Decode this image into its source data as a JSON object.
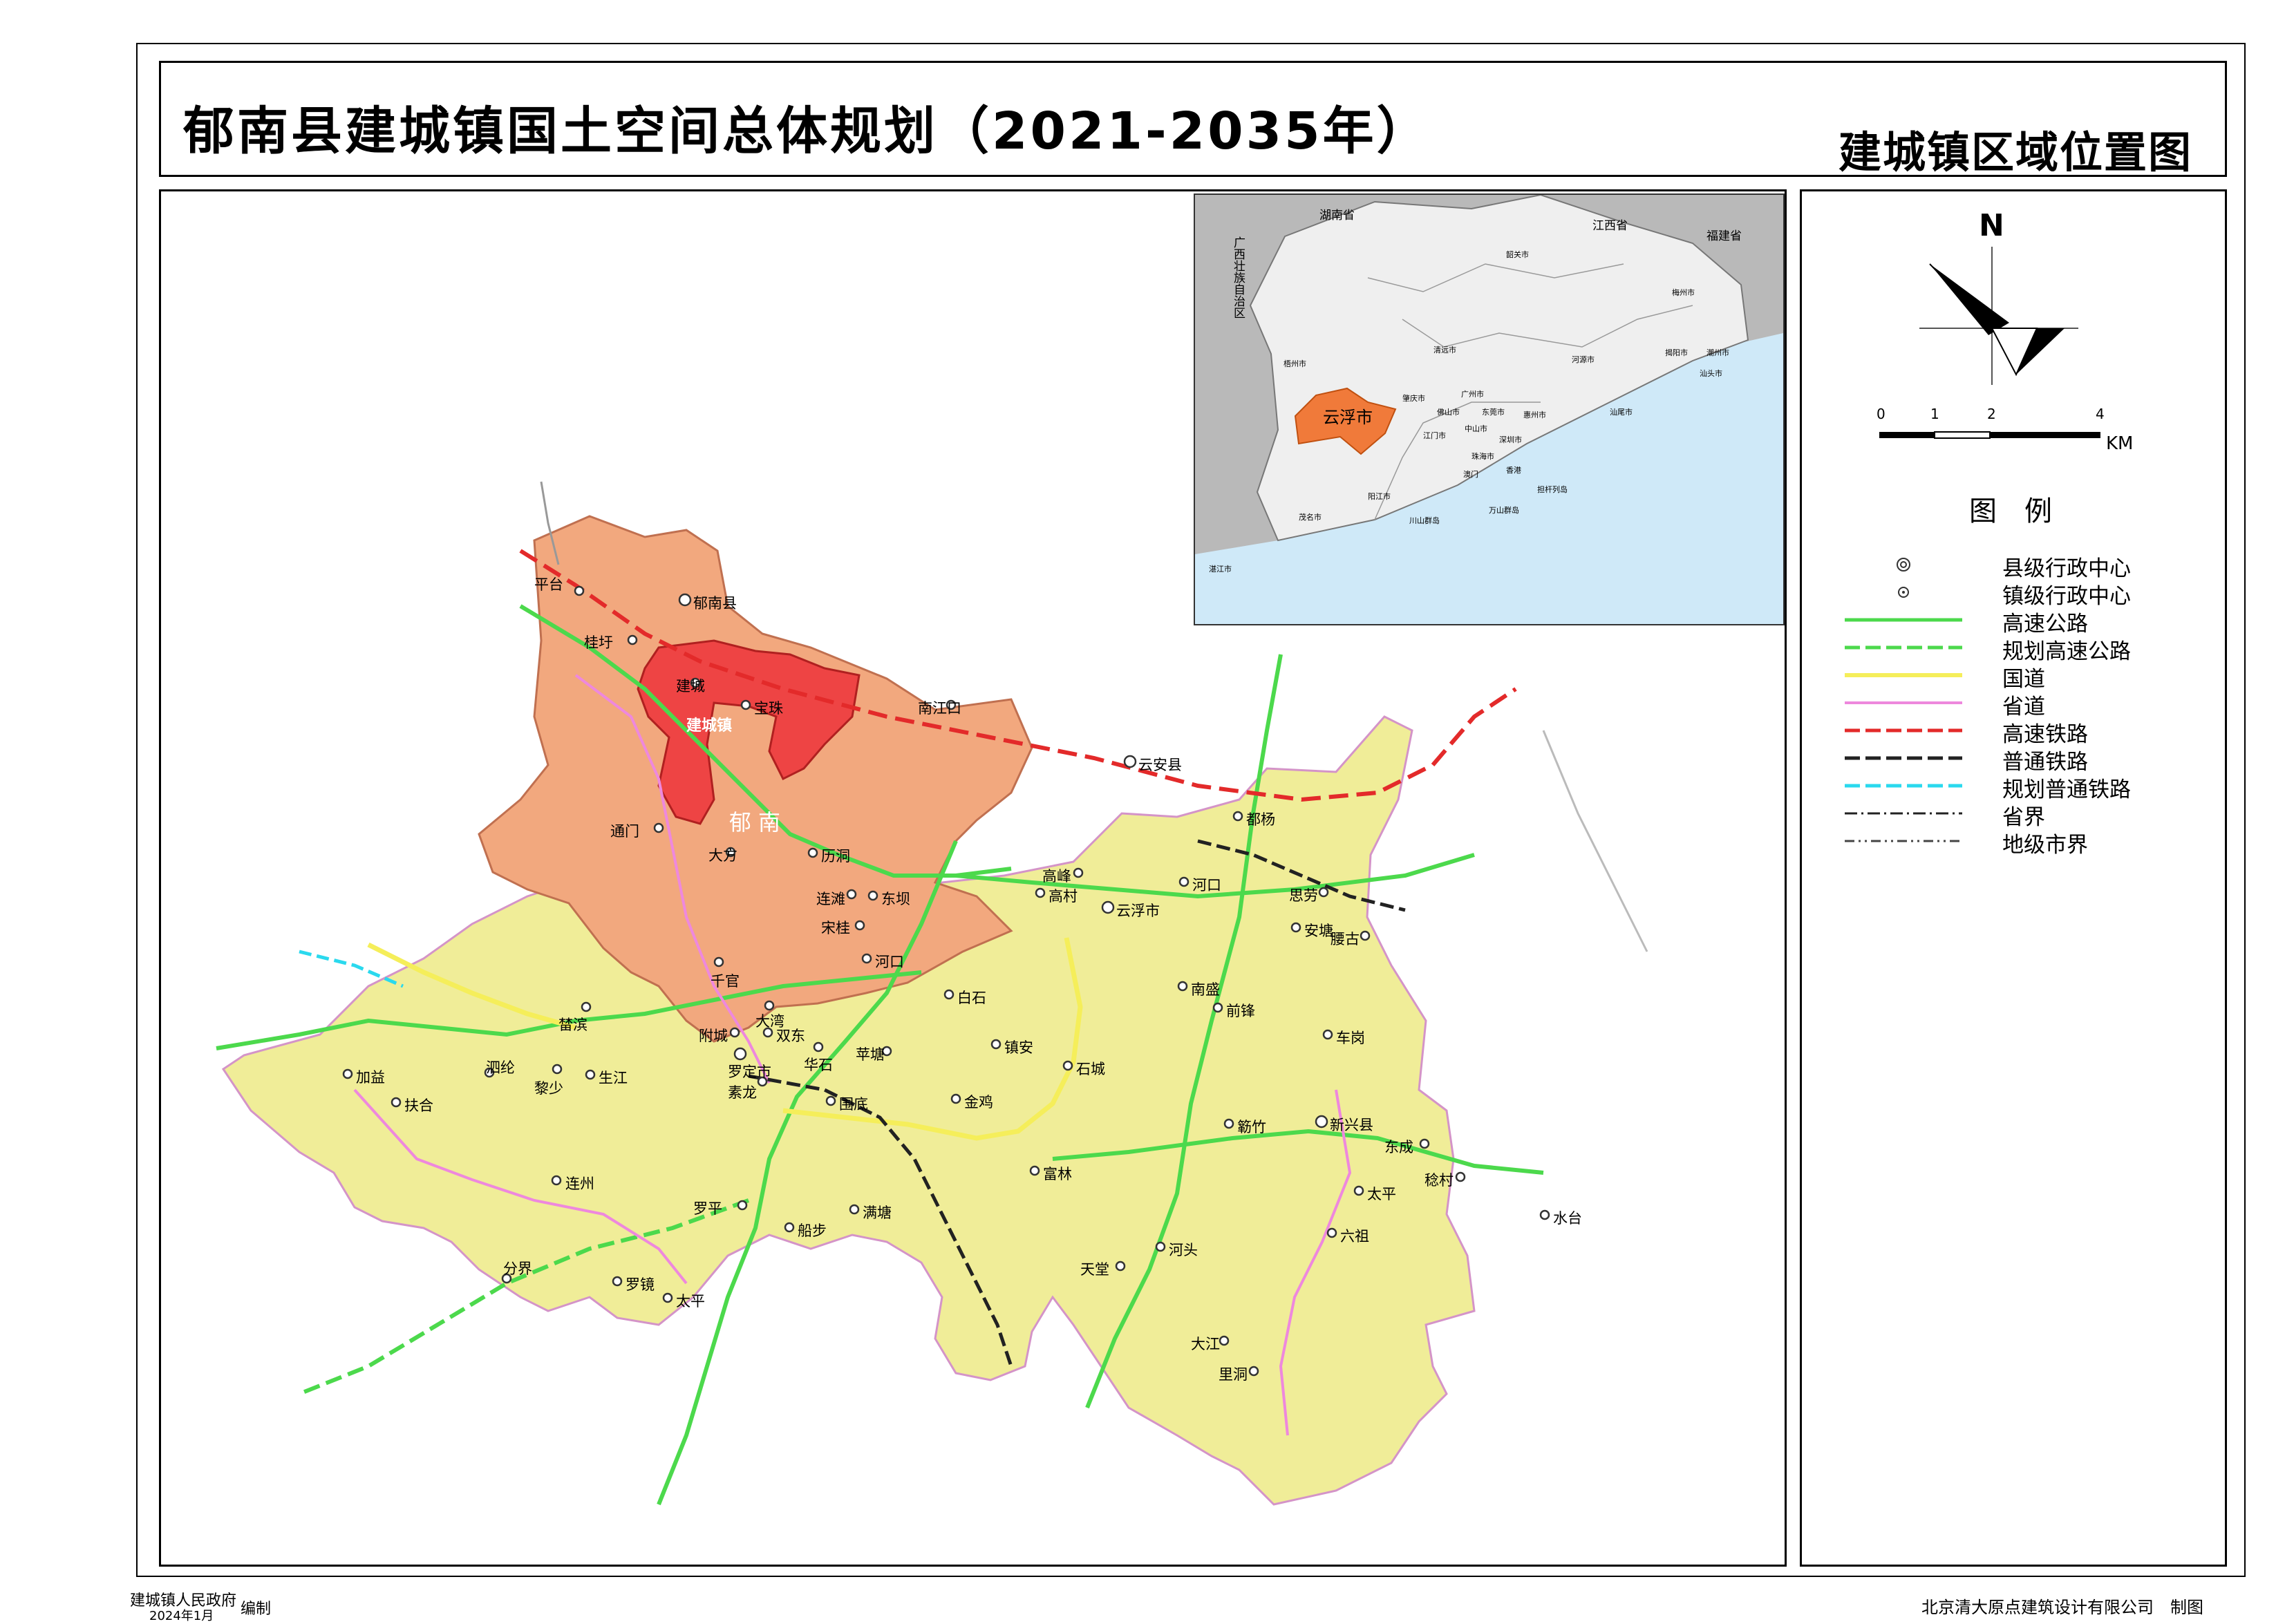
{
  "title": "郁南县建城镇国土空间总体规划（2021-2035年）",
  "subtitle": "建城镇区域位置图",
  "north_arrow": {
    "label": "N"
  },
  "scale_bar": {
    "ticks": [
      "0",
      "1",
      "2",
      "4"
    ],
    "unit": "KM"
  },
  "legend": {
    "title": "图　例",
    "items": [
      {
        "label": "县级行政中心",
        "symbol": "county-center",
        "color": "#333333"
      },
      {
        "label": "镇级行政中心",
        "symbol": "town-center",
        "color": "#333333"
      },
      {
        "label": "高速公路",
        "symbol": "line-solid",
        "color": "#4cd94c"
      },
      {
        "label": "规划高速公路",
        "symbol": "line-dashed",
        "color": "#4cd94c"
      },
      {
        "label": "国道",
        "symbol": "line-solid",
        "color": "#f5ee5a"
      },
      {
        "label": "省道",
        "symbol": "line-solid",
        "color": "#ee88dd"
      },
      {
        "label": "高速铁路",
        "symbol": "line-dashed",
        "color": "#e32a2a"
      },
      {
        "label": "普通铁路",
        "symbol": "line-dashed",
        "color": "#222222"
      },
      {
        "label": "规划普通铁路",
        "symbol": "line-dashed",
        "color": "#2ad9ee"
      },
      {
        "label": "省界",
        "symbol": "line-dashdot",
        "color": "#222222"
      },
      {
        "label": "地级市界",
        "symbol": "line-dashdot",
        "color": "#444444"
      }
    ]
  },
  "colors": {
    "county_fill": "#f2a87e",
    "town_fill": "#ee4444",
    "region_fill": "#f0ed98",
    "inset_city_fill": "#f07a3a",
    "sea": "#cfe9f8",
    "outside": "#b9b9b9"
  },
  "map": {
    "county_label": "郁南",
    "town_label": "建城镇",
    "places": [
      {
        "name": "郁南县",
        "type": "county"
      },
      {
        "name": "平台",
        "type": "town"
      },
      {
        "name": "桂圩",
        "type": "town"
      },
      {
        "name": "建城",
        "type": "town"
      },
      {
        "name": "宝珠",
        "type": "town"
      },
      {
        "name": "南江口",
        "type": "town"
      },
      {
        "name": "通门",
        "type": "town"
      },
      {
        "name": "大方",
        "type": "town"
      },
      {
        "name": "历洞",
        "type": "town"
      },
      {
        "name": "连滩",
        "type": "town"
      },
      {
        "name": "东坝",
        "type": "town"
      },
      {
        "name": "宋桂",
        "type": "town"
      },
      {
        "name": "千官",
        "type": "town"
      },
      {
        "name": "河口",
        "type": "town"
      },
      {
        "name": "云安县",
        "type": "county"
      },
      {
        "name": "都杨",
        "type": "town"
      },
      {
        "name": "高村",
        "type": "town"
      },
      {
        "name": "高峰",
        "type": "town"
      },
      {
        "name": "河口",
        "type": "town"
      },
      {
        "name": "云浮市",
        "type": "county"
      },
      {
        "name": "思劳",
        "type": "town"
      },
      {
        "name": "安塘",
        "type": "town"
      },
      {
        "name": "腰古",
        "type": "town"
      },
      {
        "name": "南盛",
        "type": "town"
      },
      {
        "name": "前锋",
        "type": "town"
      },
      {
        "name": "白石",
        "type": "town"
      },
      {
        "name": "大湾",
        "type": "town"
      },
      {
        "name": "榃滨",
        "type": "town"
      },
      {
        "name": "附城",
        "type": "town"
      },
      {
        "name": "双东",
        "type": "town"
      },
      {
        "name": "罗定市",
        "type": "county"
      },
      {
        "name": "华石",
        "type": "town"
      },
      {
        "name": "苹塘",
        "type": "town"
      },
      {
        "name": "镇安",
        "type": "town"
      },
      {
        "name": "石城",
        "type": "town"
      },
      {
        "name": "车岗",
        "type": "town"
      },
      {
        "name": "加益",
        "type": "town"
      },
      {
        "name": "扶合",
        "type": "town"
      },
      {
        "name": "泗纶",
        "type": "town"
      },
      {
        "name": "黎少",
        "type": "town"
      },
      {
        "name": "生江",
        "type": "town"
      },
      {
        "name": "素龙",
        "type": "town"
      },
      {
        "name": "围底",
        "type": "town"
      },
      {
        "name": "金鸡",
        "type": "town"
      },
      {
        "name": "簕竹",
        "type": "town"
      },
      {
        "name": "新兴县",
        "type": "county"
      },
      {
        "name": "东成",
        "type": "town"
      },
      {
        "name": "稔村",
        "type": "town"
      },
      {
        "name": "富林",
        "type": "town"
      },
      {
        "name": "连州",
        "type": "town"
      },
      {
        "name": "太平",
        "type": "town"
      },
      {
        "name": "水台",
        "type": "town"
      },
      {
        "name": "罗平",
        "type": "town"
      },
      {
        "name": "船步",
        "type": "town"
      },
      {
        "name": "满塘",
        "type": "town"
      },
      {
        "name": "六祖",
        "type": "town"
      },
      {
        "name": "河头",
        "type": "town"
      },
      {
        "name": "天堂",
        "type": "town"
      },
      {
        "name": "分界",
        "type": "town"
      },
      {
        "name": "罗镜",
        "type": "town"
      },
      {
        "name": "太平",
        "type": "town"
      },
      {
        "name": "大江",
        "type": "town"
      },
      {
        "name": "里洞",
        "type": "town"
      }
    ]
  },
  "inset": {
    "labels": [
      "湖南省",
      "江西省",
      "福建省",
      "广西壮族自治区",
      "云浮市",
      "广州市",
      "肇庆市",
      "清远市",
      "韶关市",
      "梅州市",
      "河源市",
      "惠州市",
      "东莞市",
      "佛山市",
      "中山市",
      "江门市",
      "珠海市",
      "深圳市",
      "香港",
      "澳门",
      "汕尾市",
      "揭阳市",
      "汕头市",
      "潮州市",
      "梧州市",
      "阳江市",
      "茂名市",
      "湛江市",
      "川山群岛",
      "万山群岛",
      "担杆列岛"
    ]
  },
  "footer": {
    "left_line1": "建城镇人民政府",
    "left_line2": "2024年1月",
    "left_suffix": "编制",
    "right": "北京清大原点建筑设计有限公司　制图"
  }
}
